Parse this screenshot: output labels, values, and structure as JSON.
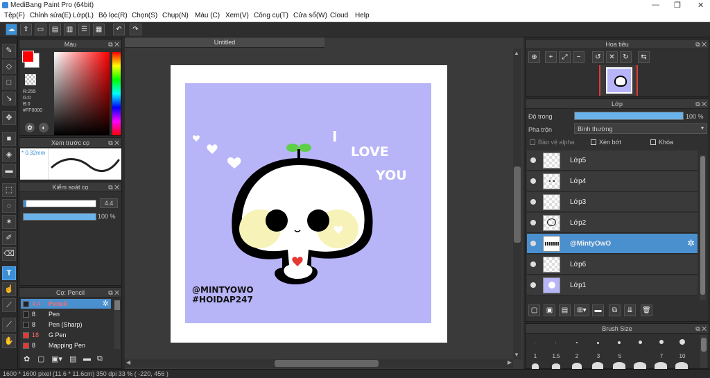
{
  "window": {
    "title": "MediBang Paint Pro (64bit)"
  },
  "menu": [
    "Tệp(F)",
    "Chỉnh sửa(E)",
    "Lớp(L)",
    "Bộ lọc(R)",
    "Chọn(S)",
    "Chụp(N)",
    "Màu (C)",
    "Xem(V)",
    "Công cụ(T)",
    "Cửa sổ(W)",
    "Cloud",
    "Help"
  ],
  "color_panel": {
    "title": "Màu",
    "r": "R:255",
    "g": "G:0",
    "b": "B:0",
    "hex": "#FF0000",
    "fg": "#ff0000"
  },
  "brush_preview": {
    "title": "Xem trước cọ",
    "size": "* 0.32mm"
  },
  "brush_control": {
    "title": "Kiểm soát cọ",
    "size_value": "4.4",
    "opacity_value": "100 %",
    "opacity": 1.0
  },
  "brush_list": {
    "title": "Cọ: Pencil",
    "items": [
      {
        "size": "4.4",
        "name": "Pencil",
        "color": "#333333",
        "selected": true
      },
      {
        "size": "8",
        "name": "Pen",
        "color": "#333333"
      },
      {
        "size": "8",
        "name": "Pen (Sharp)",
        "color": "#333333"
      },
      {
        "size": "18",
        "name": "G Pen",
        "color": "#e53935"
      },
      {
        "size": "8",
        "name": "Mapping Pen",
        "color": "#e53935"
      }
    ]
  },
  "document": {
    "tab": "Untitled"
  },
  "artwork": {
    "text_i": "I",
    "text_love": "LOVE",
    "text_you": "YOU",
    "credit1": "@MINTYOWO",
    "credit2": "#HOIDAP247",
    "bg": "#b7b4f8"
  },
  "navigator": {
    "title": "Hoa tiêu"
  },
  "layers": {
    "title": "Lớp",
    "opacity_label": "Độ trong",
    "opacity_value": "100 %",
    "opacity": 1.0,
    "blend_label": "Pha trộn",
    "blend_value": "Bình thường",
    "protect_alpha": "Bảo vệ alpha",
    "clipping": "Xén bớt",
    "lock": "Khóa",
    "items": [
      {
        "name": "Lớp5"
      },
      {
        "name": "Lớp4"
      },
      {
        "name": "Lớp3"
      },
      {
        "name": "Lớp2"
      },
      {
        "name": "@MintyOwO",
        "selected": true
      },
      {
        "name": "Lớp6"
      },
      {
        "name": "Lớp1"
      }
    ]
  },
  "brush_size": {
    "title": "Brush Size",
    "sizes": [
      "1",
      "1.5",
      "2",
      "3",
      "5",
      "7",
      "10"
    ]
  },
  "status": {
    "text": "1600 * 1600 pixel  (11.6 * 11.6cm)  350 dpi  33 %  ( -220, 456 )"
  }
}
